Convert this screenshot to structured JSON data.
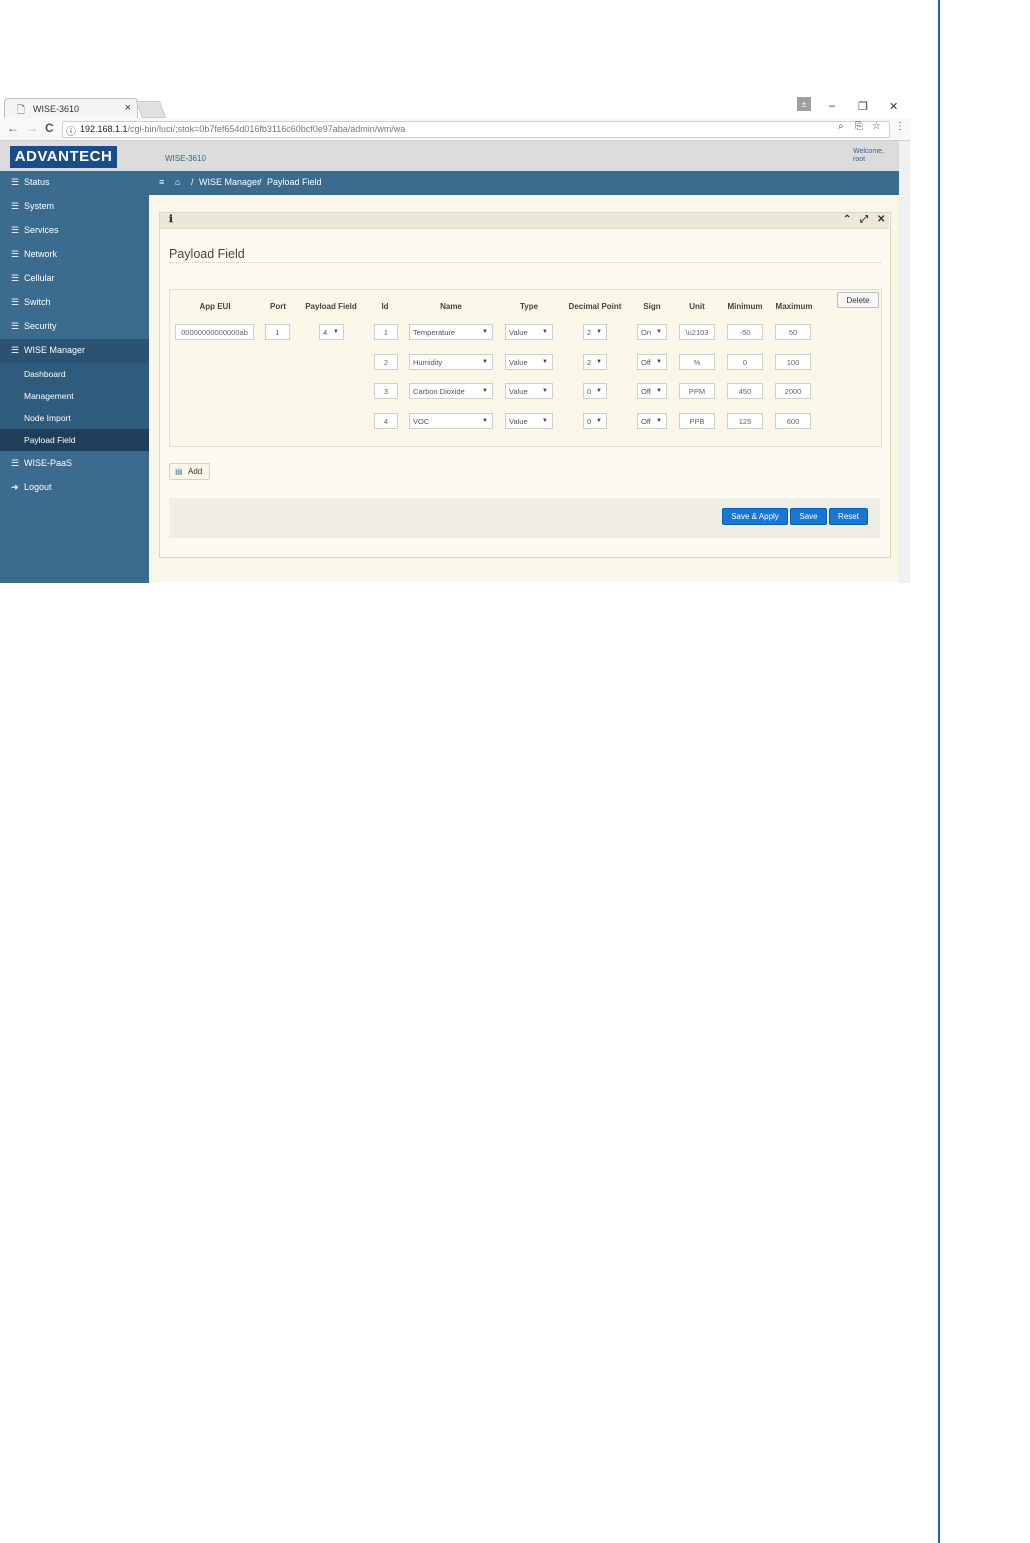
{
  "browser": {
    "tab_title": "WISE-3610",
    "url_host": "192.168.1.1",
    "url_path": "/cgi-bin/luci/;stok=0b7fef654d016fb3116c60bcf0e97aba/admin/wm/wa",
    "close_glyph": "×",
    "profile_glyph": "±",
    "min_glyph": "–",
    "restore_glyph": "❐",
    "winclose_glyph": "✕",
    "back_glyph": "←",
    "forward_glyph": "→",
    "reload_glyph": "C",
    "info_glyph": "ⓘ",
    "zoom_glyph": "⌕",
    "translate_glyph": "⎘",
    "star_glyph": "☆",
    "menu_glyph": "⋮"
  },
  "header": {
    "logo": "ADVANTECH",
    "device": "WISE-3610",
    "welcome_line1": "Welcome,",
    "welcome_line2": "root"
  },
  "sidebar": {
    "items": [
      {
        "label": "Status"
      },
      {
        "label": "System"
      },
      {
        "label": "Services"
      },
      {
        "label": "Network"
      },
      {
        "label": "Cellular"
      },
      {
        "label": "Switch"
      },
      {
        "label": "Security"
      },
      {
        "label": "WISE Manager"
      }
    ],
    "subitems": [
      {
        "label": "Dashboard"
      },
      {
        "label": "Management"
      },
      {
        "label": "Node Import"
      },
      {
        "label": "Payload Field"
      }
    ],
    "paas": "WISE-PaaS",
    "logout": "Logout"
  },
  "breadcrumb": {
    "menu_icon": "≡",
    "home_icon": "⌂",
    "sep": "/",
    "parent": "WISE Manager",
    "current": "Payload Field"
  },
  "widget": {
    "info_icon": "ℹ",
    "collapse_icon": "⌃",
    "expand_icon": "⤢",
    "close_icon": "✕"
  },
  "page": {
    "title": "Payload Field"
  },
  "table": {
    "headers": [
      "App EUI",
      "Port",
      "Payload Field",
      "Id",
      "Name",
      "Type",
      "Decimal Point",
      "Sign",
      "Unit",
      "Minimum",
      "Maximum"
    ],
    "app_eui": "00000000000000ab",
    "port": "1",
    "payload_field": "4",
    "rows": [
      {
        "id": "1",
        "name": "Temperature",
        "type": "Value",
        "decimal": "2",
        "sign": "On",
        "unit": "\\u2103",
        "min": "-50",
        "max": "50"
      },
      {
        "id": "2",
        "name": "Humidity",
        "type": "Value",
        "decimal": "2",
        "sign": "Off",
        "unit": "%",
        "min": "0",
        "max": "100"
      },
      {
        "id": "3",
        "name": "Carbon Dioxide",
        "type": "Value",
        "decimal": "0",
        "sign": "Off",
        "unit": "PPM",
        "min": "450",
        "max": "2000"
      },
      {
        "id": "4",
        "name": "VOC",
        "type": "Value",
        "decimal": "0",
        "sign": "Off",
        "unit": "PPB",
        "min": "125",
        "max": "600"
      }
    ],
    "delete_label": "Delete",
    "dropdown_arrow": "▼"
  },
  "actions": {
    "add": "Add",
    "save_apply": "Save & Apply",
    "save": "Save",
    "reset": "Reset"
  }
}
